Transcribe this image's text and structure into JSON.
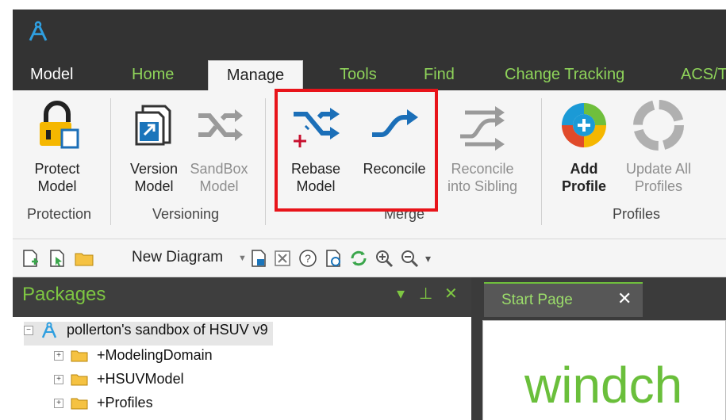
{
  "tabs": {
    "model": "Model",
    "home": "Home",
    "manage": "Manage",
    "tools": "Tools",
    "find": "Find",
    "change_tracking": "Change Tracking",
    "acs": "ACS/T"
  },
  "ribbon": {
    "protect_model": {
      "line1": "Protect",
      "line2": "Model"
    },
    "version_model": {
      "line1": "Version",
      "line2": "Model"
    },
    "sandbox_model": {
      "line1": "SandBox",
      "line2": "Model"
    },
    "rebase_model": {
      "line1": "Rebase",
      "line2": "Model"
    },
    "reconcile": {
      "line1": "Reconcile",
      "line2": ""
    },
    "reconcile_sibling": {
      "line1": "Reconcile",
      "line2": "into Sibling"
    },
    "add_profile": {
      "line1": "Add",
      "line2": "Profile"
    },
    "update_all_profiles": {
      "line1": "Update All",
      "line2": "Profiles"
    },
    "groups": {
      "protection": "Protection",
      "versioning": "Versioning",
      "merge": "Merge",
      "profiles": "Profiles"
    }
  },
  "toolbar": {
    "new_diagram": "New Diagram"
  },
  "packages": {
    "title": "Packages",
    "root": "pollerton's sandbox of HSUV v9",
    "items": [
      "+ModelingDomain",
      "+HSUVModel",
      "+Profiles"
    ]
  },
  "start_page": {
    "tab_label": "Start Page",
    "brand_text": "windch"
  },
  "colors": {
    "accent_green": "#7ec742",
    "highlight_red": "#e8141a",
    "dark_bg": "#333333"
  }
}
